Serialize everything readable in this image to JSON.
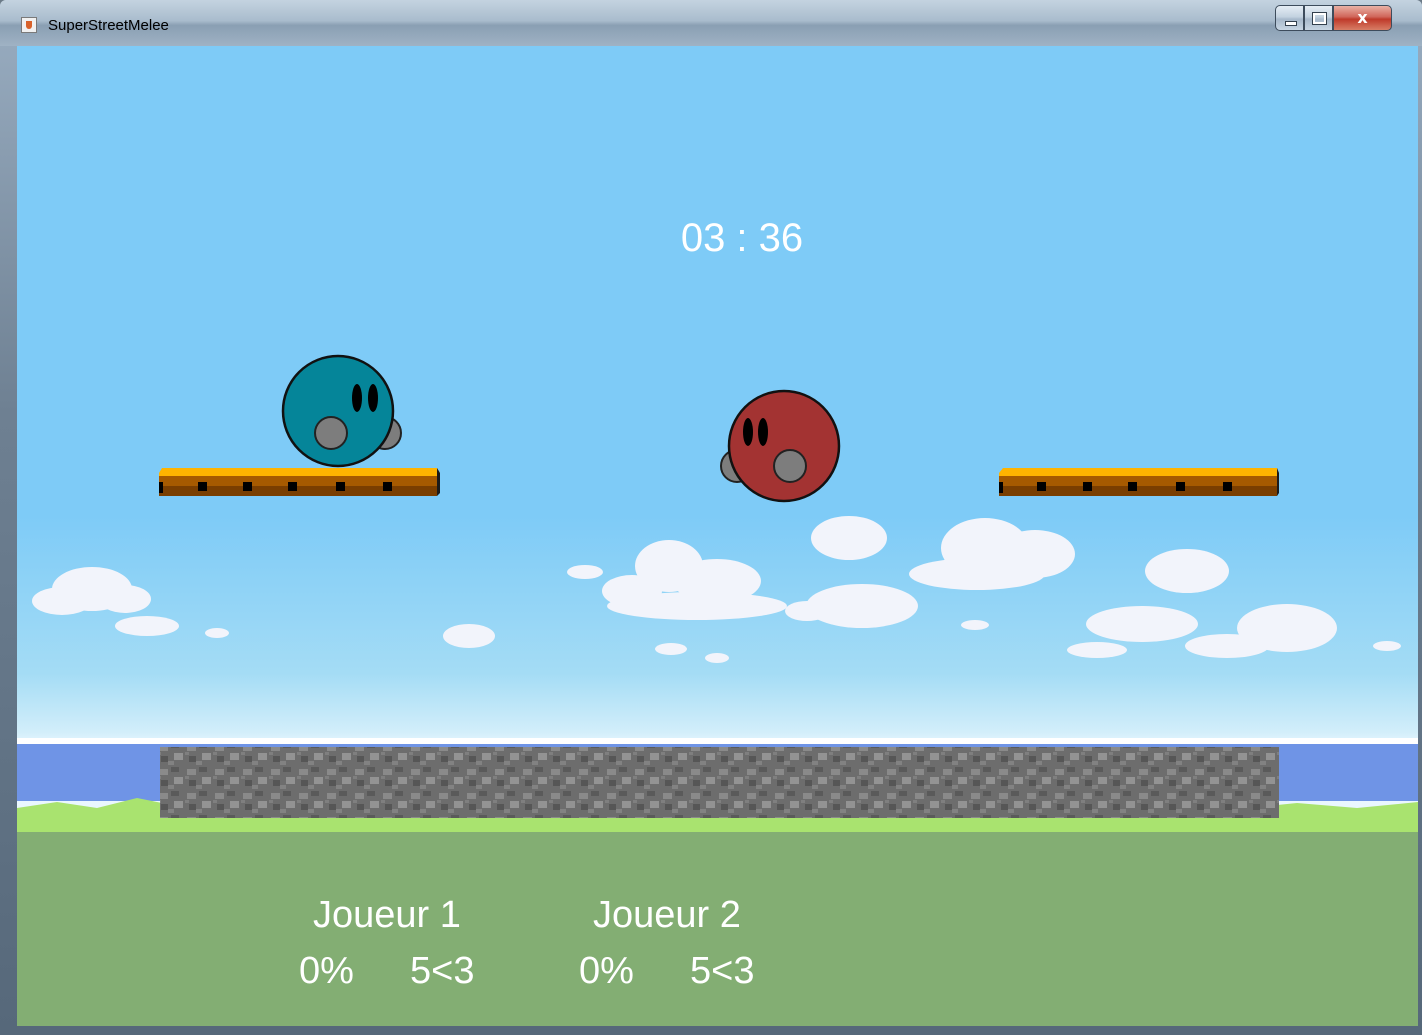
{
  "window": {
    "title": "SuperStreetMelee",
    "minimize_label": "",
    "maximize_label": "",
    "close_label": "x"
  },
  "hud": {
    "timer": "03 : 36",
    "players": [
      {
        "name": "Joueur 1",
        "damage": "0%",
        "lives": "5<3",
        "color": "#058599"
      },
      {
        "name": "Joueur 2",
        "damage": "0%",
        "lives": "5<3",
        "color": "#a33332"
      }
    ]
  },
  "scene": {
    "colors": {
      "sky": "#7ecbf7",
      "platform_top": "#ffb400",
      "platform_body": "#a65a00",
      "stone": "#6d6d6d",
      "grass": "#83ae73",
      "grass_light": "#a9e36f",
      "water": "#6f94e6",
      "hand": "#7d7d7d"
    }
  }
}
